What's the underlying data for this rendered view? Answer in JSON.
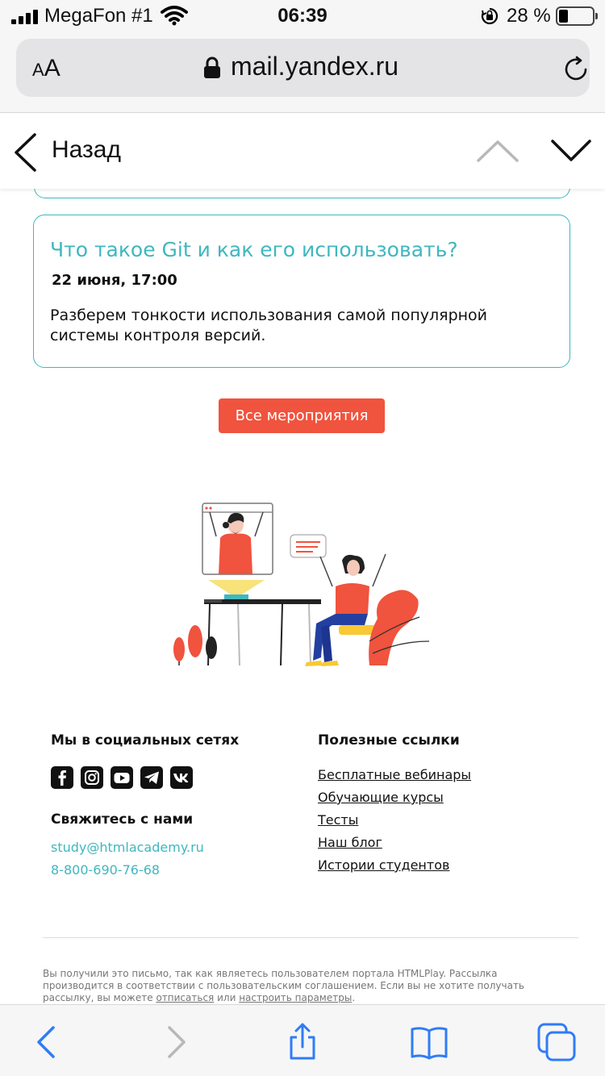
{
  "status_bar": {
    "carrier": "MegaFon #1",
    "time": "06:39",
    "battery": "28 %",
    "battery_level": 0.28
  },
  "url_bar": {
    "text_size_label_small": "A",
    "text_size_label_large": "A",
    "domain": "mail.yandex.ru"
  },
  "mail_nav": {
    "back_label": "Назад"
  },
  "event": {
    "title": "Что такое Git и как его использовать?",
    "date": "22 июня, 17:00",
    "description": "Разберем тонкости использования самой популярной системы контроля версий."
  },
  "all_events_button": "Все мероприятия",
  "footer": {
    "social_heading": "Мы в социальных сетях",
    "social_icons": [
      "facebook-icon",
      "instagram-icon",
      "youtube-icon",
      "telegram-icon",
      "vk-icon"
    ],
    "contact_heading": "Свяжитесь с нами",
    "email": "study@htmlacademy.ru",
    "phone": "8-800-690-76-68",
    "links_heading": "Полезные ссылки",
    "links": [
      "Бесплатные вебинары",
      "Обучающие курсы",
      "Тесты",
      "Наш блог",
      "Истории студентов"
    ],
    "fineprint": "Вы получили это письмо, так как являетесь пользователем портала HTMLPlay. Рассылка производится в соответствии с пользовательским соглашением. Если вы не хотите получать рассылку, вы можете",
    "unsubscribe": "отписаться",
    "or": "или",
    "settings": "настроить параметры",
    "fineprint_end": "."
  },
  "colors": {
    "accent_teal": "#3fb7bf",
    "button_red": "#f0533e",
    "ios_blue": "#2f7cf6"
  }
}
